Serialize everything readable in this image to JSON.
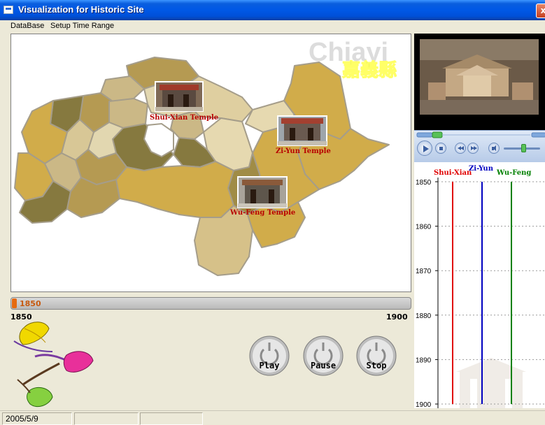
{
  "window": {
    "title": "Visualization for Historic Site",
    "close_label": "x"
  },
  "menu": {
    "items": [
      {
        "label": "DataBase"
      },
      {
        "label": "Setup Time Range"
      }
    ]
  },
  "map": {
    "watermark": "Chiayi",
    "region_title": "嘉義縣",
    "temples": [
      {
        "name": "Shui-Xian Temple"
      },
      {
        "name": "Zi-Yun Temple"
      },
      {
        "name": "Wu-Feng Temple"
      }
    ]
  },
  "timeline": {
    "current": "1850",
    "min": "1850",
    "max": "1900",
    "position_fraction": 0.0
  },
  "controls": {
    "play": "Play",
    "pause": "Pause",
    "stop": "Stop"
  },
  "chart_data": {
    "type": "line",
    "orientation": "vertical-time",
    "y_ticks": [
      "1850",
      "1860",
      "1870",
      "1880",
      "1890",
      "1900"
    ],
    "ylim": [
      1850,
      1900
    ],
    "grid": true,
    "series": [
      {
        "name": "Shui-Xian",
        "color": "#e00000",
        "start": 1850,
        "end": 1900
      },
      {
        "name": "Zi-Yun",
        "color": "#0000c0",
        "start": 1850,
        "end": 1900
      },
      {
        "name": "Wu-Feng",
        "color": "#008000",
        "start": 1850,
        "end": 1900
      }
    ]
  },
  "status": {
    "date": "2005/5/9"
  },
  "colors": {
    "accent": "#0058e6",
    "timeline_thumb": "#e56a10",
    "temple_label": "#b80000"
  }
}
